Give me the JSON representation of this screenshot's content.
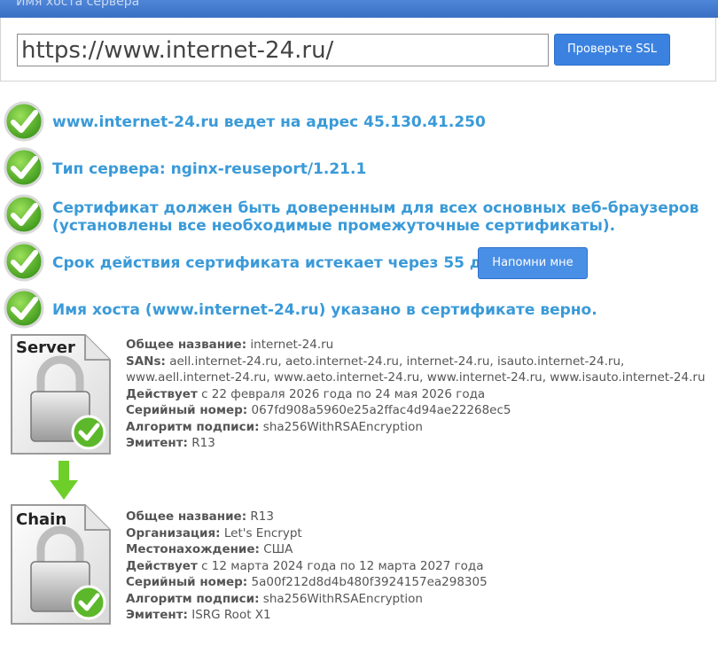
{
  "header": {
    "label": "Имя хоста сервера"
  },
  "search": {
    "value": "https://www.internet-24.ru/",
    "button": "Проверьте SSL"
  },
  "checks": [
    "www.internet-24.ru ведет на адрес 45.130.41.250",
    "Тип сервера: nginx-reuseport/1.21.1",
    "Сертификат должен быть доверенным для всех основных веб-браузеров",
    "(установлены все необходимые промежуточные сертификаты).",
    "Срок действия сертификата истекает через 55 дней.",
    "Имя хоста (www.internet-24.ru) указано в сертификате верно."
  ],
  "remind_button": "Напомни мне",
  "server_cert": {
    "badge": "Server",
    "common_name_label": "Общее название:",
    "common_name": " internet-24.ru",
    "sans_label": "SANs:",
    "sans_line1": " aell.internet-24.ru, aeto.internet-24.ru, internet-24.ru, isauto.internet-24.ru,",
    "sans_line2": "www.aell.internet-24.ru, www.aeto.internet-24.ru, www.internet-24.ru, www.isauto.internet-24.ru",
    "valid_label": "Действует",
    "valid": " с 22 февраля 2026 года по 24 мая 2026 года",
    "serial_label": "Серийный номер:",
    "serial": " 067fd908a5960e25a2ffac4d94ae22268ec5",
    "algo_label": "Алгоритм подписи:",
    "algo": " sha256WithRSAEncryption",
    "issuer_label": "Эмитент:",
    "issuer": " R13"
  },
  "chain_cert": {
    "badge": "Chain",
    "common_name_label": "Общее название:",
    "common_name": " R13",
    "org_label": "Организация:",
    "org": " Let's Encrypt",
    "location_label": "Местонахождение:",
    "location": " США",
    "valid_label": "Действует",
    "valid": " с 12 марта 2024 года по 12 марта 2027 года",
    "serial_label": "Серийный номер:",
    "serial": " 5a00f212d8d4b480f3924157ea298305",
    "algo_label": "Алгоритм подписи:",
    "algo": " sha256WithRSAEncryption",
    "issuer_label": "Эмитент:",
    "issuer": " ISRG Root X1"
  },
  "colors": {
    "accent": "#3a9ad8",
    "button": "#3b82e0",
    "check": "#5cb82a"
  }
}
